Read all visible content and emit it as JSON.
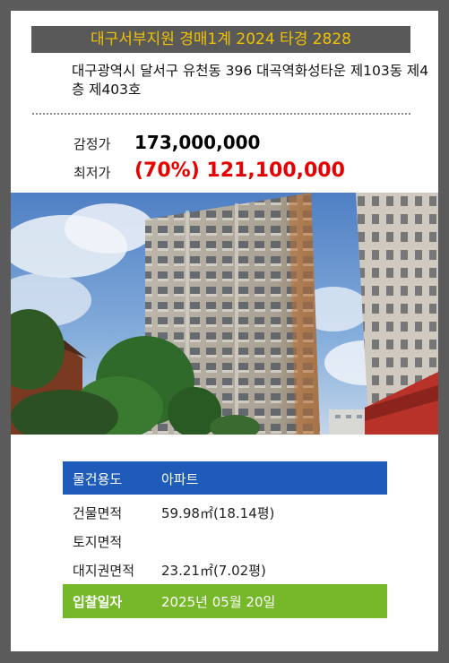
{
  "header": {
    "court_case": "대구서부지원 경매1계 2024 타경 2828"
  },
  "property": {
    "address": "대구광역시 달서구 유천동 396 대곡역화성타운 제103동 제4층 제403호"
  },
  "prices": {
    "appraisal_label": "감정가",
    "appraisal_value": "173,000,000",
    "minimum_label": "최저가",
    "minimum_value": "(70%) 121,100,000"
  },
  "photo": {
    "icon": "apartment-building-photo"
  },
  "details": {
    "usage_label": "물건용도",
    "usage_value": "아파트",
    "building_area_label": "건물면적",
    "building_area_value": "59.98㎡(18.14평)",
    "land_area_label": "토지면적",
    "land_area_value": "",
    "land_rights_label": "대지권면적",
    "land_rights_value": "23.21㎡(7.02평)",
    "bid_date_label": "입찰일자",
    "bid_date_value": "2025년 05월 20일"
  },
  "colors": {
    "background": "#5b5b5b",
    "banner_bg": "#595959",
    "banner_text": "#f2c200",
    "minimum_price": "#e60000",
    "usage_row": "#1f5bb8",
    "date_row": "#76b82a"
  }
}
